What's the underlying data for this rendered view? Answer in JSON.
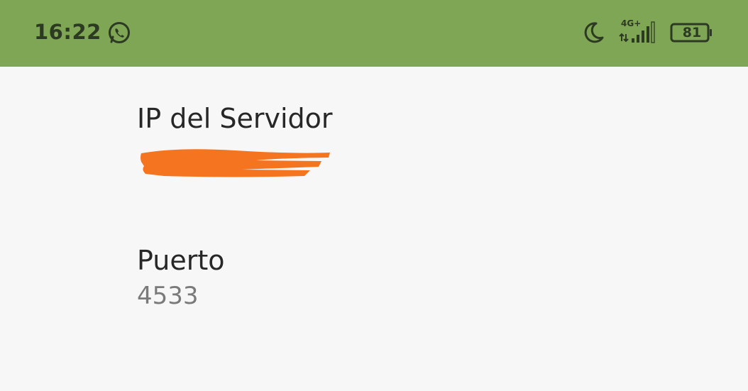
{
  "status_bar": {
    "time": "16:22",
    "network_label": "4G+",
    "battery_level": "81",
    "background_color": "#7ea655",
    "icons": [
      "whatsapp-icon",
      "moon-icon",
      "signal-icon",
      "battery-icon"
    ]
  },
  "settings": {
    "server_ip": {
      "title": "IP del Servidor",
      "value_redacted": true,
      "redaction_color": "#f5741f"
    },
    "port": {
      "title": "Puerto",
      "value": "4533"
    }
  }
}
